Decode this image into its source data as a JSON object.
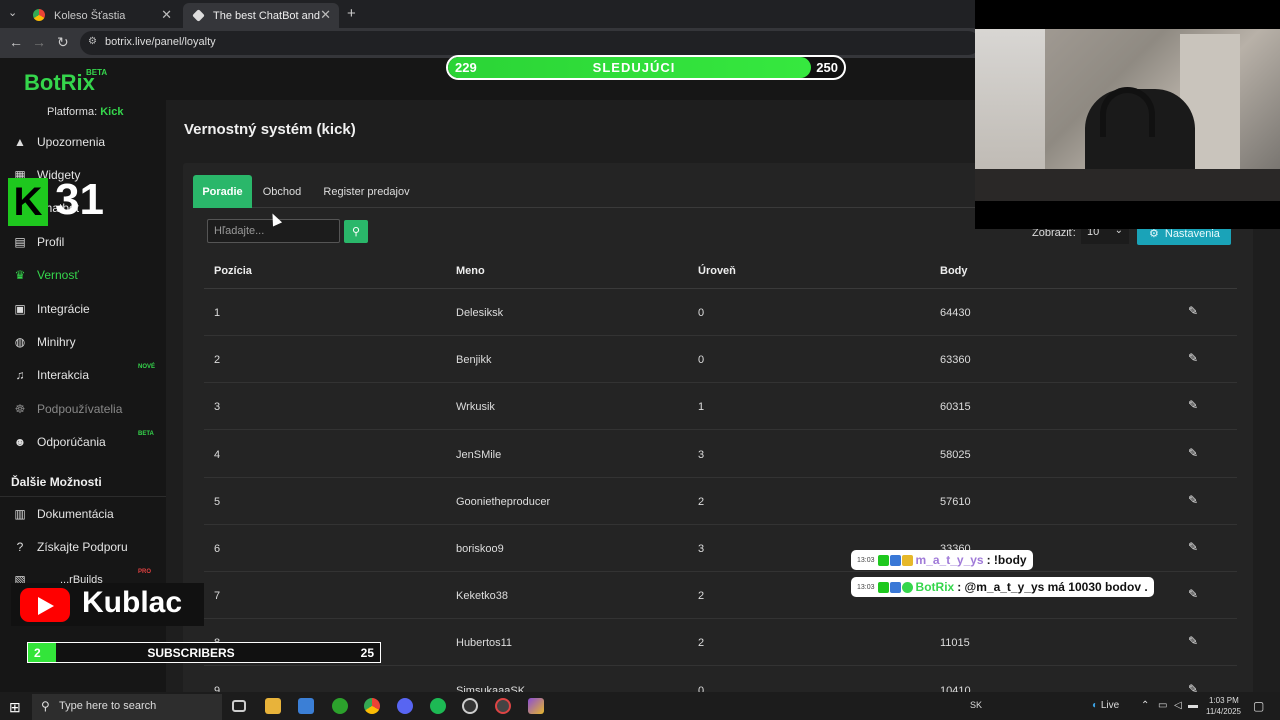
{
  "browser": {
    "tabs": [
      {
        "title": "Koleso Šťastia"
      },
      {
        "title": "The best ChatBot and Widgets"
      }
    ],
    "new_tab": "+",
    "url": "botrix.live/panel/loyalty"
  },
  "sidebar": {
    "logo": "BotRix",
    "logo_badge": "BETA",
    "platform_label": "Platforma:",
    "platform_value": "Kick",
    "items": [
      {
        "label": "Upozornenia",
        "icon": "warning-icon",
        "badge": ""
      },
      {
        "label": "Widgety",
        "icon": "widgets-icon",
        "badge": ""
      },
      {
        "label": "Chatbot",
        "icon": "chat-icon",
        "badge": ""
      },
      {
        "label": "Profil",
        "icon": "profile-card-icon",
        "badge": ""
      },
      {
        "label": "Vernosť",
        "icon": "trophy-icon",
        "badge": ""
      },
      {
        "label": "Integrácie",
        "icon": "integration-icon",
        "badge": ""
      },
      {
        "label": "Minihry",
        "icon": "gamepad-icon",
        "badge": ""
      },
      {
        "label": "Interakcia",
        "icon": "music-icon",
        "badge": "NOVÉ"
      },
      {
        "label": "Podpoužívatelia",
        "icon": "subusers-icon",
        "badge": ""
      },
      {
        "label": "Odporúčania",
        "icon": "referrals-icon",
        "badge": "BETA"
      }
    ],
    "section_title": "Ďalšie Možnosti",
    "more_items": [
      {
        "label": "Dokumentácia",
        "icon": "docs-icon"
      },
      {
        "label": "Získajte Podporu",
        "icon": "help-icon"
      },
      {
        "label": "...rBuilds",
        "icon": "builds-icon",
        "badge": "PRO"
      }
    ]
  },
  "header": {
    "follow_goal": {
      "current": "229",
      "label": "SLEDUJÚCI",
      "target": "250",
      "progress": 0.916
    }
  },
  "main": {
    "title": "Vernostný systém (kick)",
    "tabs": [
      {
        "label": "Poradie",
        "active": true
      },
      {
        "label": "Obchod",
        "active": false
      },
      {
        "label": "Register predajov",
        "active": false
      }
    ],
    "search_placeholder": "Hľadajte...",
    "show_label": "Zobraziť:",
    "show_value": "10",
    "settings_label": "Nastavenia",
    "columns": [
      "Pozícia",
      "Meno",
      "Úroveň",
      "Body"
    ],
    "rows": [
      {
        "pos": "1",
        "name": "Delesiksk",
        "level": "0",
        "points": "64430"
      },
      {
        "pos": "2",
        "name": "Benjikk",
        "level": "0",
        "points": "63360"
      },
      {
        "pos": "3",
        "name": "Wrkusik",
        "level": "1",
        "points": "60315"
      },
      {
        "pos": "4",
        "name": "JenSMile",
        "level": "3",
        "points": "58025"
      },
      {
        "pos": "5",
        "name": "Goonietheproducer",
        "level": "2",
        "points": "57610"
      },
      {
        "pos": "6",
        "name": "boriskoo9",
        "level": "3",
        "points": "33360"
      },
      {
        "pos": "7",
        "name": "Keketko38",
        "level": "2",
        "points": ""
      },
      {
        "pos": "8",
        "name": "Hubertos11",
        "level": "2",
        "points": "11015"
      },
      {
        "pos": "9",
        "name": "SimsukaaaSK",
        "level": "0",
        "points": "10410"
      }
    ]
  },
  "overlay": {
    "kick_count": "31",
    "kick_letter": "K",
    "yt_name": "Kublac",
    "subs": {
      "current": "2",
      "label": "SUBSCRIBERS",
      "target": "25",
      "progress": 0.08
    },
    "chat": [
      {
        "time": "13:03",
        "user": "m_a_t_y_ys",
        "message": ": !body"
      },
      {
        "time": "13:03",
        "user": "BotRix",
        "message": ": @m_a_t_y_ys má 10030 bodov ."
      }
    ]
  },
  "taskbar": {
    "search_placeholder": "Type here to search",
    "lang": "SK",
    "live": "Live",
    "time": "1:03 PM",
    "date": "11/4/2025"
  },
  "colors": {
    "accent": "#35d64c",
    "tab_active": "#2ab76a",
    "settings": "#1aa3b8"
  }
}
